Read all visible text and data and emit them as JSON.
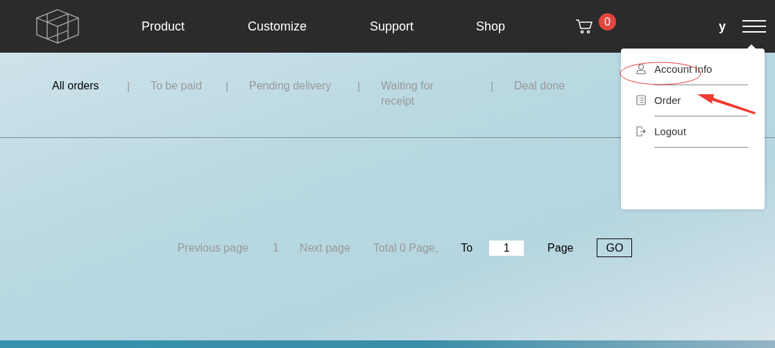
{
  "header": {
    "nav": [
      "Product",
      "Customize",
      "Support",
      "Shop"
    ],
    "cart_count": "0",
    "user": "y"
  },
  "tabs": [
    {
      "label": "All orders",
      "selected": true
    },
    {
      "label": "To be paid",
      "selected": false
    },
    {
      "label": "Pending delivery",
      "selected": false
    },
    {
      "label": "Waiting for receipt",
      "selected": false
    },
    {
      "label": "Deal done",
      "selected": false
    }
  ],
  "tab_separator": "|",
  "pagination": {
    "previous": "Previous page",
    "current": "1",
    "next": "Next page",
    "total": "Total 0 Page,",
    "to": "To",
    "page_value": "1",
    "page": "Page",
    "go": "GO"
  },
  "menu": [
    {
      "kind": "account",
      "label": "Account Info"
    },
    {
      "kind": "order",
      "label": "Order"
    },
    {
      "kind": "logout",
      "label": "Logout"
    }
  ]
}
